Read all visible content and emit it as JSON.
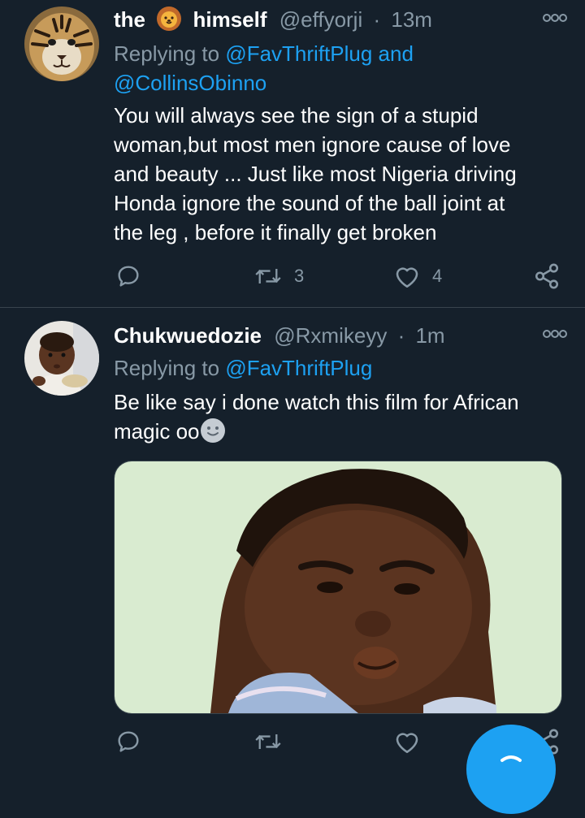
{
  "tweet1": {
    "name_part1": "the",
    "name_part2": "himself",
    "handle": "@effyorji",
    "dot": "·",
    "time": "13m",
    "replying_prefix": "Replying to ",
    "mention1": "@FavThriftPlug",
    "and": " and",
    "mention2": "@CollinsObinno",
    "text_lines": [
      "You will always see the sign of a stupid",
      "woman,but most men ignore cause of love",
      "and beauty ... Just like most Nigeria driving",
      "Honda ignore the sound of the ball joint at",
      "the leg , before it finally get broken"
    ],
    "retweet_count": "3",
    "like_count": "4"
  },
  "tweet2": {
    "name": "Chukwuedozie",
    "handle": "@Rxmikeyy",
    "dot": "·",
    "time": "1m",
    "replying_prefix": "Replying to ",
    "mention1": "@FavThriftPlug",
    "text_lines": [
      "Be like say i done watch this film for African",
      "magic oo"
    ]
  },
  "icons": {
    "more": "more-dots-icon",
    "reply": "reply-icon",
    "retweet": "retweet-icon",
    "like": "heart-icon",
    "share": "share-icon",
    "compose": "compose-icon",
    "lion_emoji": "lion-face-emoji",
    "smiley_emoji": "slightly-smiling-face-emoji"
  },
  "colors": {
    "background": "#15202b",
    "secondary_text": "#8899a6",
    "accent": "#1da1f2",
    "divider": "#38444d"
  }
}
